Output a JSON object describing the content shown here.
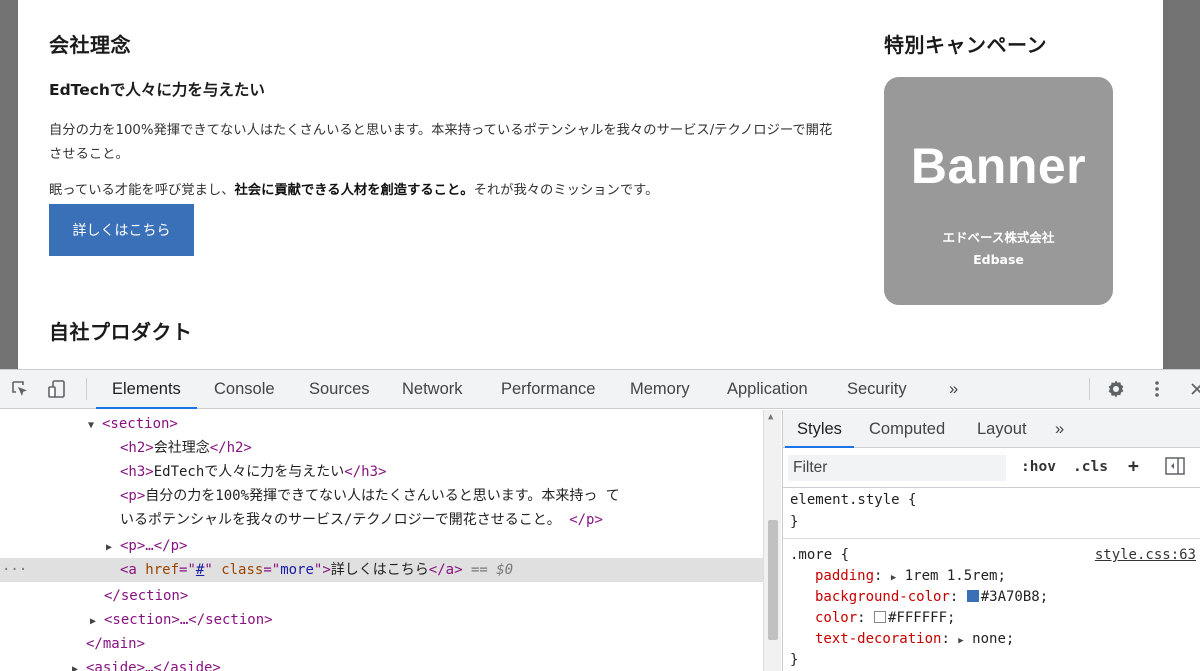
{
  "page": {
    "philosophy_title": "会社理念",
    "philosophy_subtitle": "EdTechで人々に力を与えたい",
    "para1": "自分の力を100%発揮できてない人はたくさんいると思います。本来持っているポテンシャルを我々のサービス/テクノロジーで開花させること。",
    "para2_pre": "眠っている才能を呼び覚まし、",
    "para2_bold": "社会に貢献できる人材を創造すること。",
    "para2_post": "それが我々のミッションです。",
    "more_button": "詳しくはこちら",
    "products_title": "自社プロダクト",
    "campaign_title": "特別キャンペーン",
    "banner": {
      "big": "Banner",
      "company": "エドベース株式会社",
      "english": "Edbase"
    }
  },
  "devtools": {
    "tabs": [
      "Elements",
      "Console",
      "Sources",
      "Network",
      "Performance",
      "Memory",
      "Application",
      "Security"
    ],
    "active_tab": "Elements",
    "more_tabs": "»",
    "dom": {
      "section_open": "<section>",
      "h2": {
        "open": "<h2>",
        "text": "会社理念",
        "close": "</h2>"
      },
      "h3": {
        "open": "<h3>",
        "text": "EdTechで人々に力を与えたい",
        "close": "</h3>"
      },
      "p1": {
        "open": "<p>",
        "text1": "自分の力を100%発揮できてない人はたくさんいると思います。本来持っ て",
        "text2": "いるポテンシャルを我々のサービス/テクノロジーで開花させること。 ",
        "close": "</p>"
      },
      "p2_collapsed": "<p>…</p>",
      "a": {
        "open": "<a",
        "href_attr": "href",
        "href_val": "#",
        "class_attr": "class",
        "class_val": "more",
        "text": "詳しくはこちら",
        "close": "</a>",
        "eq": "== $0"
      },
      "section_close": "</section>",
      "section2_collapsed": "<section>…</section>",
      "main_close": "</main>",
      "aside_collapsed": "<aside>…</aside>",
      "dots": "···"
    },
    "styles": {
      "tabs": [
        "Styles",
        "Computed",
        "Layout"
      ],
      "active_tab": "Styles",
      "more_tabs": "»",
      "filter_placeholder": "Filter",
      "hov": ":hov",
      "cls": ".cls",
      "plus": "+",
      "element_style": "element.style {",
      "close_brace": "}",
      "rule_selector": ".more {",
      "rule_source": "style.css:63",
      "props": [
        {
          "name": "padding",
          "value": "1rem 1.5rem;",
          "expandable": true
        },
        {
          "name": "background-color",
          "value": "#3A70B8;",
          "swatch": "#3A70B8"
        },
        {
          "name": "color",
          "value": "#FFFFFF;",
          "swatch": "#FFFFFF"
        },
        {
          "name": "text-decoration",
          "value": "none;",
          "expandable": true
        }
      ]
    }
  }
}
